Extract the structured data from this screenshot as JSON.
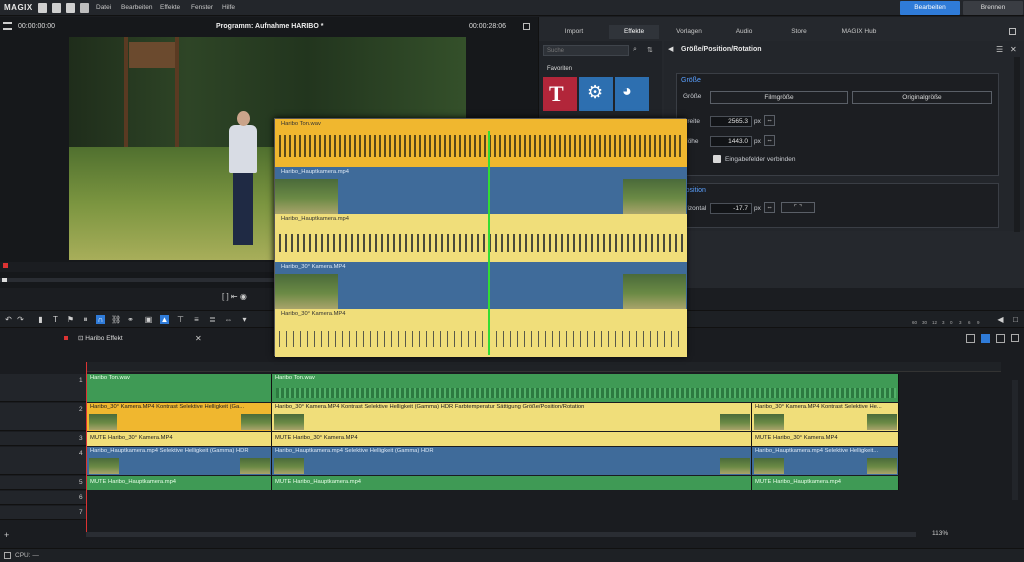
{
  "app": {
    "logo": "MAGIX"
  },
  "menu": [
    "Datei",
    "Bearbeiten",
    "Effekte",
    "Fenster",
    "Hilfe"
  ],
  "modes": {
    "edit": "Bearbeiten",
    "burn": "Brennen"
  },
  "program": {
    "time_left": "00:00:00:00",
    "title": "Programm: Aufnahme HARIBO *",
    "time_right": "00:00:28:06"
  },
  "panel": {
    "tabs": [
      "Import",
      "Effekte",
      "Vorlagen",
      "Audio",
      "Store",
      "MAGIX Hub"
    ],
    "search_placeholder": "Suche",
    "favorites": "Favoriten",
    "title": "Größe/Position/Rotation",
    "section_size": "Größe",
    "size_label": "Größe",
    "btn_film": "Filmgröße",
    "btn_orig": "Originalgröße",
    "width_label": "Breite",
    "width_val": "2565.3",
    "height_label": "Höhe",
    "height_val": "1443.0",
    "unit": "px",
    "link_label": "Eingabefelder verbinden",
    "section_pos": "Position",
    "horiz_label": "Horizontal",
    "horiz_val": "-17.7"
  },
  "timeline": {
    "tab": "Haribo Effekt",
    "zoom": "113%",
    "cpu": "CPU: —",
    "tracks": [
      "1",
      "2",
      "3",
      "4",
      "5",
      "6",
      "7"
    ],
    "meter_ticks": [
      "60",
      "30",
      "12",
      "3",
      "0",
      "3",
      "6",
      "9"
    ]
  },
  "clips": {
    "t1a": "Haribo Ton.wav",
    "t1b": "Haribo Ton.wav",
    "t2a": "Haribo_30° Kamera.MP4   Kontrast   Selektive Helligkeit (Ga...",
    "t2b": "Haribo_30° Kamera.MP4   Kontrast   Selektive Helligkeit (Gamma)   HDR   Farbtemperatur   Sättigung   Größe/Position/Rotation",
    "t2c": "Haribo_30° Kamera.MP4   Kontrast   Selektive He...",
    "t3a": "MUTE Haribo_30° Kamera.MP4",
    "t3b": "MUTE Haribo_30° Kamera.MP4",
    "t3c": "MUTE Haribo_30° Kamera.MP4",
    "t4a": "Haribo_Hauptkamera.mp4   Selektive Helligkeit (Gamma)   HDR",
    "t4b": "Haribo_Hauptkamera.mp4   Selektive Helligkeit (Gamma)   HDR",
    "t4c": "Haribo_Hauptkamera.mp4   Selektive Helligkeit...",
    "t5a": "MUTE Haribo_Hauptkamera.mp4",
    "t5b": "MUTE Haribo_Hauptkamera.mp4",
    "t5c": "MUTE Haribo_Hauptkamera.mp4"
  },
  "overlay": {
    "r1": "Haribo Ton.wav",
    "r2": "Haribo_Hauptkamera.mp4",
    "r3": "Haribo_Hauptkamera.mp4",
    "r4": "Haribo_30° Kamera.MP4",
    "r5": "Haribo_30° Kamera.MP4"
  },
  "colors": {
    "accent": "#2f7bd8",
    "green_clip": "#3f9a55",
    "yellow_clip": "#f0de7a",
    "blue_clip": "#3f6b9a",
    "playhead": "#33dd33"
  }
}
